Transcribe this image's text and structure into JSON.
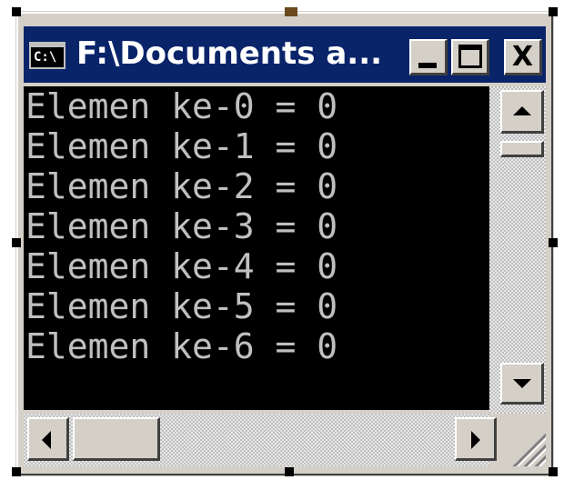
{
  "window": {
    "title": "F:\\Documents a...",
    "icon_text": "C:\\",
    "icon": "console-icon"
  },
  "caption_buttons": {
    "minimize": "minimize-icon",
    "maximize": "maximize-icon",
    "close_label": "X"
  },
  "console": {
    "lines": [
      "Elemen ke-0 = 0",
      "Elemen ke-1 = 0",
      "Elemen ke-2 = 0",
      "Elemen ke-3 = 0",
      "Elemen ke-4 = 0",
      "Elemen ke-5 = 0",
      "Elemen ke-6 = 0"
    ]
  },
  "scrollbars": {
    "vertical_up": "arrow-up-icon",
    "vertical_down": "arrow-down-icon",
    "horizontal_left": "arrow-left-icon",
    "horizontal_right": "arrow-right-icon"
  },
  "colors": {
    "title_bar": "#0a246a",
    "console_bg": "#000000",
    "console_text": "#c0c0c0",
    "chrome": "#d4d0c8"
  }
}
